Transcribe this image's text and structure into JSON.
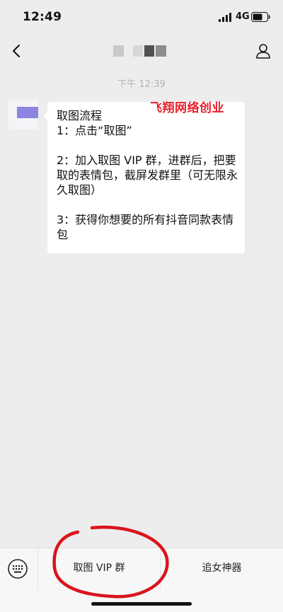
{
  "status_bar": {
    "time": "12:49",
    "network": "4G"
  },
  "chat": {
    "timestamp": "下午 12:39",
    "message": "取图流程\n1：点击“取图”\n\n2：加入取图 VIP 群，进群后，把要取的表情包，截屏发群里（可无限永久取图）\n\n3：获得你想要的所有抖音同款表情包",
    "watermark": "飞翔网络创业"
  },
  "bottom_menu": {
    "items": [
      {
        "label": "取图 VIP 群"
      },
      {
        "label": "追女神器"
      }
    ]
  },
  "colors": {
    "background": "#ededed",
    "bubble": "#ffffff",
    "watermark": "#e8202a",
    "annotation": "#d9141e"
  }
}
